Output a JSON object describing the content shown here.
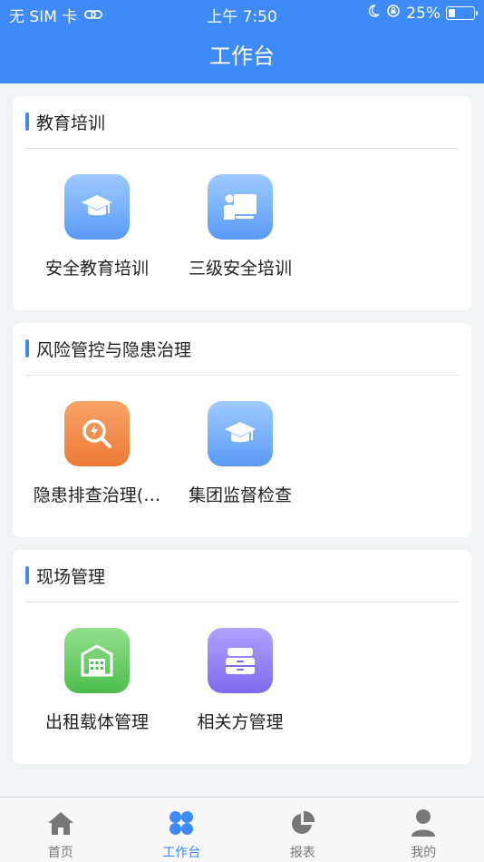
{
  "status_bar": {
    "carrier": "无 SIM 卡",
    "time": "上午 7:50",
    "battery": "25%",
    "battery_level": 0.25
  },
  "header": {
    "title": "工作台"
  },
  "sections": [
    {
      "title": "教育培训",
      "items": [
        {
          "label": "安全教育培训",
          "icon": "graduation-cap-icon",
          "color": "#5a9af5"
        },
        {
          "label": "三级安全培训",
          "icon": "teacher-board-icon",
          "color": "#5a9af5"
        }
      ]
    },
    {
      "title": "风险管控与隐患治理",
      "items": [
        {
          "label": "隐患排查治理(…",
          "icon": "hazard-search-icon",
          "color": "#ec7a36"
        },
        {
          "label": "集团监督检查",
          "icon": "graduation-cap-icon",
          "color": "#5a9af5"
        }
      ]
    },
    {
      "title": "现场管理",
      "items": [
        {
          "label": "出租载体管理",
          "icon": "warehouse-icon",
          "color": "#4cbd4c"
        },
        {
          "label": "相关方管理",
          "icon": "cabinet-icon",
          "color": "#7f69ee"
        }
      ]
    }
  ],
  "tabbar": {
    "items": [
      {
        "label": "首页",
        "icon": "home-icon",
        "active": false
      },
      {
        "label": "工作台",
        "icon": "grid-icon",
        "active": true
      },
      {
        "label": "报表",
        "icon": "pie-chart-icon",
        "active": false
      },
      {
        "label": "我的",
        "icon": "user-icon",
        "active": false
      }
    ],
    "active_color": "#3e8af6"
  },
  "colors": {
    "primary": "#3e8af6",
    "background": "#f2f3f5"
  }
}
